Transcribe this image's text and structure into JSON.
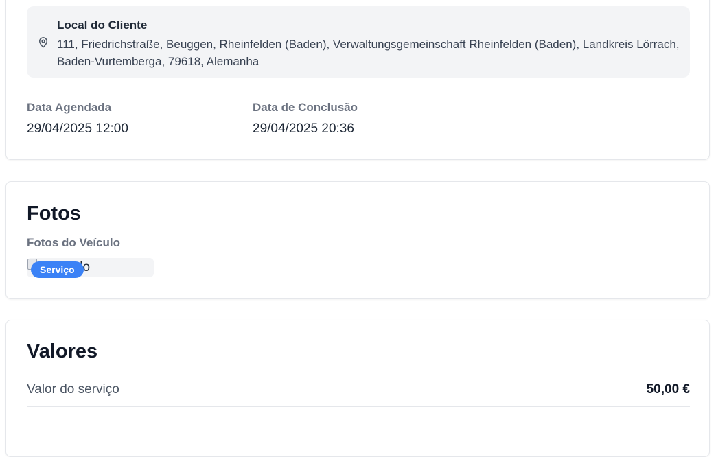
{
  "details": {
    "location": {
      "title": "Local do Cliente",
      "address": "111, Friedrichstraße, Beuggen, Rheinfelden (Baden), Verwaltungsgemeinschaft Rheinfelden (Baden), Landkreis Lörrach, Baden-Vurtemberga, 79618, Alemanha",
      "icon": "map-pin-icon"
    },
    "scheduled": {
      "label": "Data Agendada",
      "value": "29/04/2025 12:00"
    },
    "completed": {
      "label": "Data de Conclusão",
      "value": "29/04/2025 20:36"
    }
  },
  "photos": {
    "title": "Fotos",
    "subtitle": "Fotos do Veículo",
    "items": [
      {
        "alt_visible": "o veículo",
        "badge": "Serviço"
      }
    ]
  },
  "values": {
    "title": "Valores",
    "rows": [
      {
        "label": "Valor do serviço",
        "amount": "50,00 €"
      }
    ]
  },
  "colors": {
    "accent": "#3b82f6",
    "panel_bg": "#f3f4f6",
    "border": "#e5e7eb",
    "muted_text": "#6b7280"
  }
}
